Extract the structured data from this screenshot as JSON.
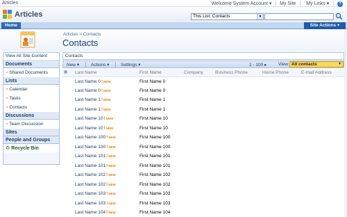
{
  "global": {
    "site_name": "Articles",
    "welcome": "Welcome System Account",
    "my_site": "My Site",
    "my_links": "My Links",
    "help": "?"
  },
  "title_area": {
    "app_title": "Articles",
    "scope": "This List: Contacts",
    "search_placeholder": ""
  },
  "nav": {
    "home_tab": "Home",
    "site_actions": "Site Actions"
  },
  "page": {
    "breadcrumb": "Articles > Contacts",
    "title": "Contacts"
  },
  "leftnav": {
    "view_all": "View All Site Content",
    "documents_head": "Documents",
    "shared_documents": "Shared Documents",
    "lists_head": "Lists",
    "calendar": "Calendar",
    "tasks": "Tasks",
    "contacts": "Contacts",
    "discussions_head": "Discussions",
    "team_discussion": "Team Discussion",
    "sites_head": "Sites",
    "people_head": "People and Groups",
    "recycle_bin": "Recycle Bin"
  },
  "main": {
    "view_title": "Contacts",
    "toolbar": {
      "new": "New",
      "actions": "Actions",
      "settings": "Settings",
      "paging": "1 - 100",
      "view_label": "View:",
      "view_value": "All contacts"
    },
    "columns": [
      "Last Name",
      "First Name",
      "Company",
      "Business Phone",
      "Home Phone",
      "E-mail Address"
    ],
    "new_badge": "NEW",
    "rows": [
      {
        "last": "Last Name 0",
        "first": "First Name 0"
      },
      {
        "last": "Last Name 0",
        "first": "First Name 0"
      },
      {
        "last": "Last Name 1",
        "first": "First Name 1"
      },
      {
        "last": "Last Name 1",
        "first": "First Name 1"
      },
      {
        "last": "Last Name 10",
        "first": "First Name 10"
      },
      {
        "last": "Last Name 10",
        "first": "First Name 10"
      },
      {
        "last": "Last Name 100",
        "first": "First Name 100"
      },
      {
        "last": "Last Name 100",
        "first": "First Name 100"
      },
      {
        "last": "Last Name 101",
        "first": "First Name 101"
      },
      {
        "last": "Last Name 101",
        "first": "First Name 101"
      },
      {
        "last": "Last Name 102",
        "first": "First Name 102"
      },
      {
        "last": "Last Name 102",
        "first": "First Name 102"
      },
      {
        "last": "Last Name 103",
        "first": "First Name 103"
      },
      {
        "last": "Last Name 103",
        "first": "First Name 103"
      },
      {
        "last": "Last Name 104",
        "first": "First Name 104"
      }
    ]
  }
}
